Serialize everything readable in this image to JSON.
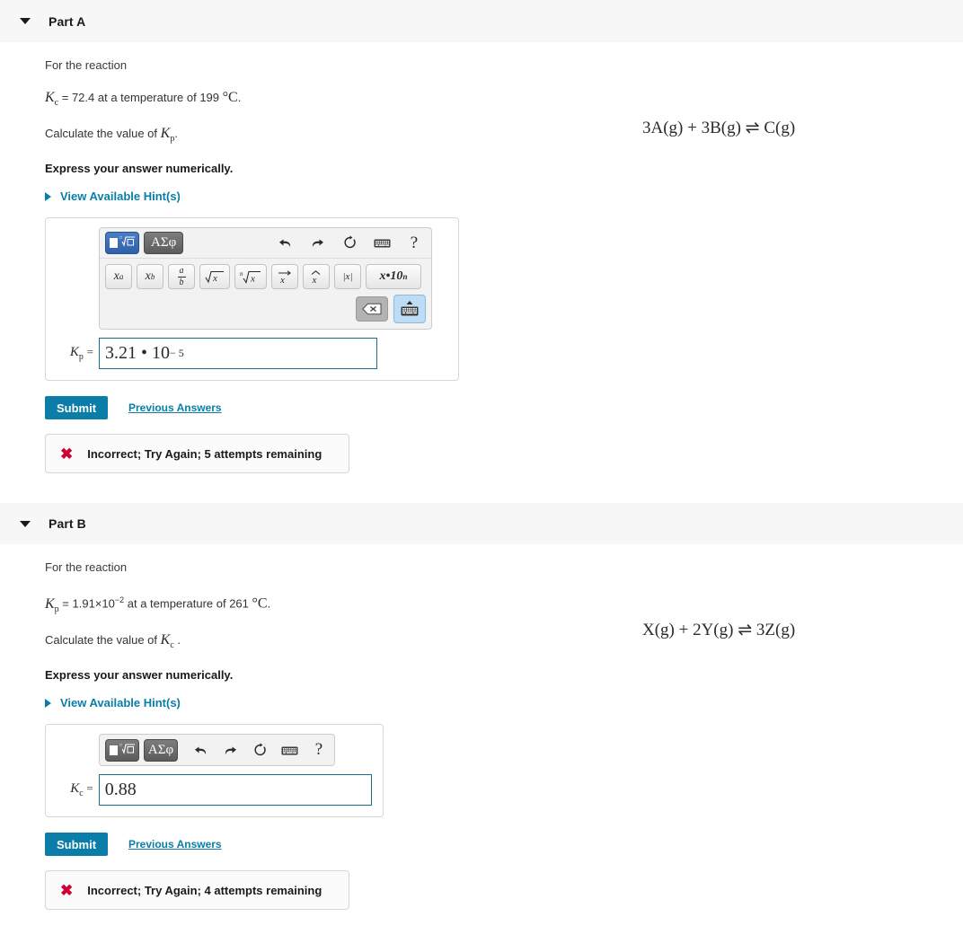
{
  "parts": [
    {
      "id": "part-a",
      "title": "Part A",
      "for_the_reaction": "For the reaction",
      "reaction": "3A(g) + 3B(g) ⇌ C(g)",
      "given_var": "K",
      "given_sub": "c",
      "given_text": "= 72.4 at a temperature of 199",
      "given_unit": "°C",
      "given_period": ".",
      "calculate_prefix": "Calculate the value of",
      "calculate_var": "K",
      "calculate_sub": "p",
      "calculate_period": ".",
      "express": "Express your answer numerically.",
      "hints": "View Available Hint(s)",
      "toolbar": {
        "mode_template_label": "template-mode",
        "mode_greek_label": "ΑΣφ",
        "undo": "undo-icon",
        "redo": "redo-icon",
        "reset": "reset-icon",
        "keyboard": "keyboard-icon",
        "help": "?",
        "templates": [
          {
            "name": "superscript",
            "base": "x",
            "sup": "a"
          },
          {
            "name": "subscript",
            "base": "x",
            "sub": "b"
          },
          {
            "name": "fraction",
            "num": "a",
            "den": "b"
          },
          {
            "name": "square-root",
            "base": "x"
          },
          {
            "name": "nth-root",
            "index": "n",
            "base": "x"
          },
          {
            "name": "vector",
            "base": "x"
          },
          {
            "name": "unit-vector",
            "base": "x"
          },
          {
            "name": "absolute-value",
            "label": "|x|"
          },
          {
            "name": "scientific-notation",
            "label": "x•10",
            "sup": "n"
          }
        ],
        "backspace": "backspace-icon",
        "keyboard_toggle": "keyboard-up-icon"
      },
      "answer_label_var": "K",
      "answer_label_sub": "p",
      "answer_equals": "=",
      "answer_value_mantissa": "3.21 • 10",
      "answer_value_exponent": "− 5",
      "submit": "Submit",
      "previous_answers": "Previous Answers",
      "feedback": "Incorrect; Try Again; 5 attempts remaining",
      "feedback_icon": "✖"
    },
    {
      "id": "part-b",
      "title": "Part B",
      "for_the_reaction": "For the reaction",
      "reaction": "X(g) + 2Y(g) ⇌ 3Z(g)",
      "given_var": "K",
      "given_sub": "p",
      "given_text": "= 1.91×10",
      "given_text_exp": "−2",
      "given_text_tail": " at a temperature of 261",
      "given_unit": "°C",
      "given_period": ".",
      "calculate_prefix": "Calculate the value of",
      "calculate_var": "K",
      "calculate_sub": "c",
      "calculate_period": ".",
      "express": "Express your answer numerically.",
      "hints": "View Available Hint(s)",
      "toolbar": {
        "mode_template_label": "template-mode",
        "mode_greek_label": "ΑΣφ",
        "undo": "undo-icon",
        "redo": "redo-icon",
        "reset": "reset-icon",
        "keyboard": "keyboard-icon",
        "help": "?"
      },
      "answer_label_var": "K",
      "answer_label_sub": "c",
      "answer_equals": "=",
      "answer_value": "0.88",
      "submit": "Submit",
      "previous_answers": "Previous Answers",
      "feedback": "Incorrect; Try Again; 4 attempts remaining",
      "feedback_icon": "✖"
    }
  ],
  "colors": {
    "accent": "#0a7ea8",
    "error": "#cc0033",
    "header_band": "#f7f7f7",
    "input_border": "#15718f",
    "mode_active": "#2f61ab"
  }
}
